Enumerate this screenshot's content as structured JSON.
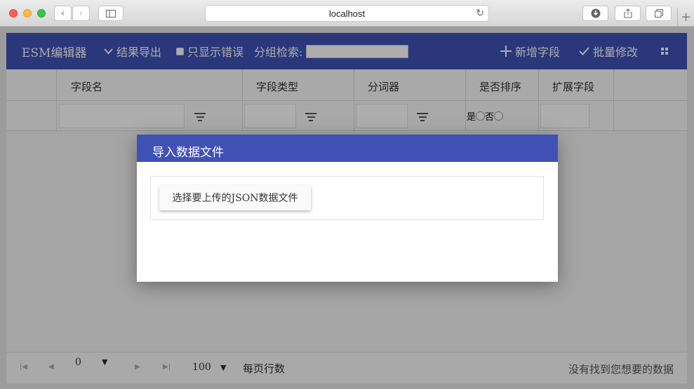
{
  "browser": {
    "url": "localhost"
  },
  "toolbar": {
    "brand": "ESM编辑器",
    "export_label": "结果导出",
    "errors_only_label": "只显示错误",
    "group_search_label": "分组检索:",
    "group_search_value": "",
    "add_field_label": "新增字段",
    "batch_edit_label": "批量修改"
  },
  "table": {
    "columns": [
      "字段名",
      "字段类型",
      "分词器",
      "是否排序",
      "扩展字段"
    ],
    "sort_options": [
      "是",
      "否"
    ]
  },
  "footer": {
    "page_value": "0",
    "rows_per_page_value": "100",
    "rows_per_page_label": "每页行数",
    "empty_message": "没有找到您想要的数据"
  },
  "dialog": {
    "title": "导入数据文件",
    "upload_button_label": "选择要上传的JSON数据文件"
  },
  "colors": {
    "primary": "#3f51b5",
    "overlay": "rgba(0,0,0,0.32)"
  }
}
